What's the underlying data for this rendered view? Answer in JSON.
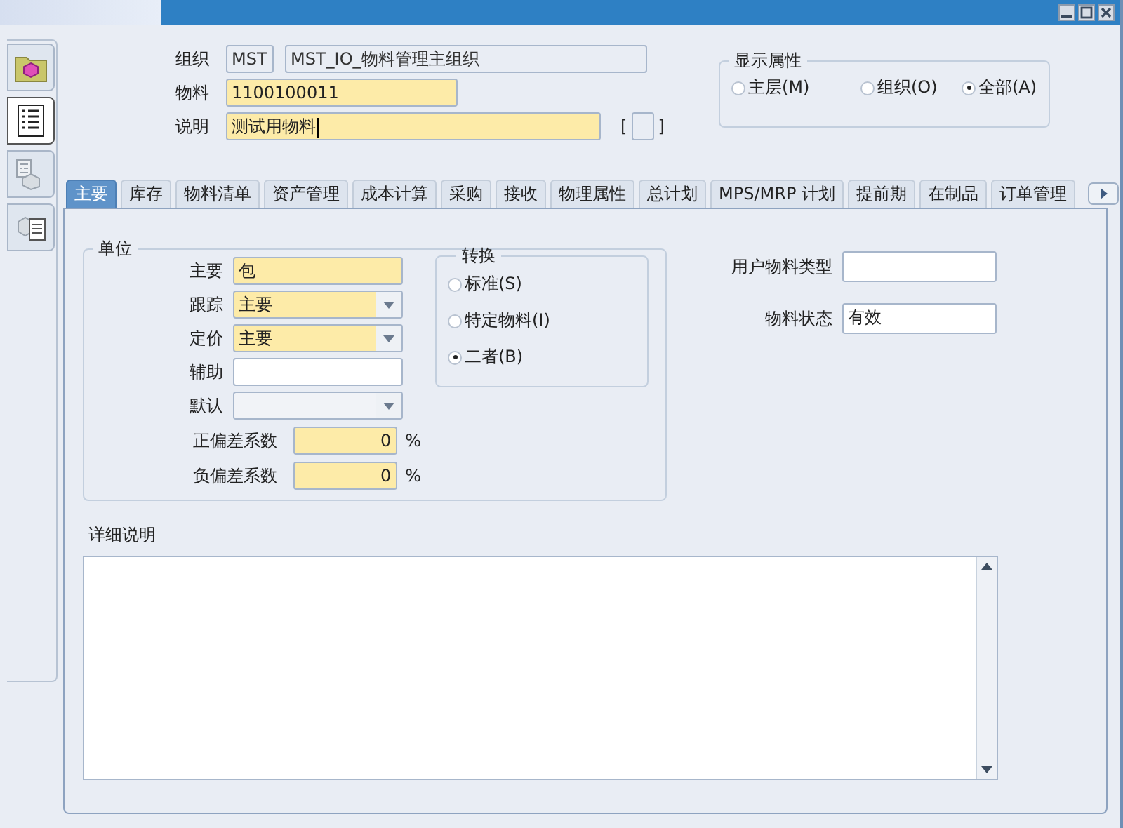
{
  "header": {
    "rows": [
      {
        "label": "组织",
        "fields": [
          {
            "value": "MST",
            "disabled": true,
            "focused": false
          },
          {
            "value": "MST_IO_物料管理主组织",
            "disabled": true,
            "focused": false
          }
        ]
      },
      {
        "label": "物料",
        "fields": [
          {
            "value": "1100100011",
            "required": true,
            "disabled": false,
            "focused": false
          }
        ]
      },
      {
        "label": "说明",
        "fields": [
          {
            "value": "测试用物料",
            "required": true,
            "disabled": false,
            "focused": true
          }
        ],
        "flex_field": {
          "open": "[",
          "close": "]"
        }
      }
    ]
  },
  "side_tabs": [
    {
      "selected": false
    },
    {
      "selected": true
    },
    {
      "selected": false
    },
    {
      "selected": false
    }
  ],
  "display_attributes": {
    "title": "显示属性",
    "options": [
      {
        "label": "主层(M)",
        "selected": false
      },
      {
        "label": "组织(O)",
        "selected": false
      },
      {
        "label": "全部(A)",
        "selected": true
      }
    ]
  },
  "tabs": [
    {
      "label": "主要",
      "selected": true
    },
    {
      "label": "库存",
      "selected": false
    },
    {
      "label": "物料清单",
      "selected": false
    },
    {
      "label": "资产管理",
      "selected": false
    },
    {
      "label": "成本计算",
      "selected": false
    },
    {
      "label": "采购",
      "selected": false
    },
    {
      "label": "接收",
      "selected": false
    },
    {
      "label": "物理属性",
      "selected": false
    },
    {
      "label": "总计划",
      "selected": false
    },
    {
      "label": "MPS/MRP 计划",
      "selected": false
    },
    {
      "label": "提前期",
      "selected": false
    },
    {
      "label": "在制品",
      "selected": false
    },
    {
      "label": "订单管理",
      "selected": false
    }
  ],
  "main_tab": {
    "unit": {
      "title": "单位",
      "fields": [
        {
          "label": "主要",
          "kind": "text",
          "value": "包",
          "required": true
        },
        {
          "label": "跟踪",
          "kind": "select",
          "value": "主要",
          "required": true
        },
        {
          "label": "定价",
          "kind": "select",
          "value": "主要",
          "required": true
        },
        {
          "label": "辅助",
          "kind": "text",
          "required": false
        },
        {
          "label": "默认",
          "kind": "select",
          "required": false
        }
      ],
      "coefficients": [
        {
          "label": "正偏差系数",
          "value": "0",
          "unit": "%"
        },
        {
          "label": "负偏差系数",
          "value": "0",
          "unit": "%"
        }
      ],
      "conversion": {
        "title": "转换",
        "options": [
          {
            "label": "标准(S)",
            "selected": false
          },
          {
            "label": "特定物料(I)",
            "selected": false
          },
          {
            "label": "二者(B)",
            "selected": true
          }
        ]
      }
    },
    "item_fields": [
      {
        "label": "用户物料类型"
      },
      {
        "label": "物料状态",
        "value": "有效"
      }
    ],
    "details": {
      "label": "详细说明"
    }
  }
}
